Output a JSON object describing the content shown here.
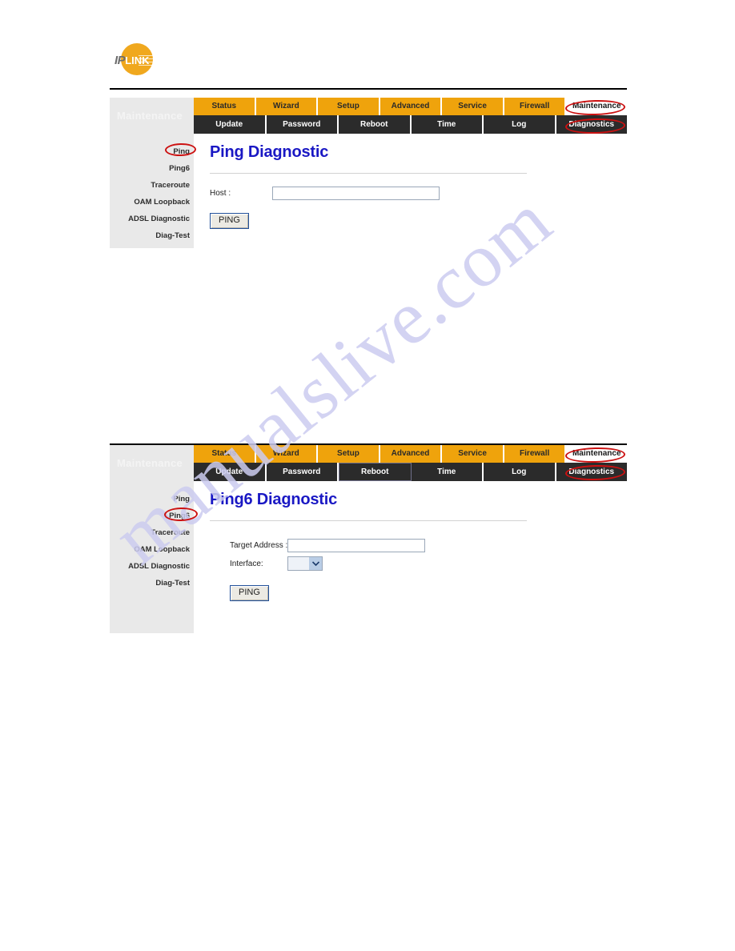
{
  "watermark": {
    "text": "manualslive.com"
  },
  "logo": {
    "part1": "IP",
    "part2": "LINK",
    "name": "iplink-logo"
  },
  "nav": {
    "brand": "Maintenance",
    "primary_tabs": [
      "Status",
      "Wizard",
      "Setup",
      "Advanced",
      "Service",
      "Firewall",
      "Maintenance"
    ],
    "secondary_tabs": [
      "Update",
      "Password",
      "Reboot",
      "Time",
      "Log",
      "Diagnostics"
    ],
    "active_primary": "Maintenance",
    "active_secondary": "Diagnostics"
  },
  "sidebar": {
    "items": [
      "Ping",
      "Ping6",
      "Traceroute",
      "OAM Loopback",
      "ADSL Diagnostic",
      "Diag-Test"
    ]
  },
  "panel_ping": {
    "title": "Ping Diagnostic",
    "host_label": "Host :",
    "host_value": "",
    "host_placeholder": "",
    "button_label": "PING",
    "highlighted_sidebar_item": "Ping"
  },
  "panel_ping6": {
    "title": "Ping6 Diagnostic",
    "target_label": "Target Address :",
    "target_value": "",
    "target_placeholder": "",
    "interface_label": "Interface:",
    "interface_value": "",
    "button_label": "PING",
    "highlighted_sidebar_item": "Ping6",
    "hovered_secondary_tab": "Reboot"
  },
  "colors": {
    "nav_orange": "#EFA30C",
    "nav_dark": "#2b2b2b",
    "title_blue": "#1a18c4",
    "sidebar_gray": "#e9e9e9",
    "annotation_red": "#cc1111",
    "watermark_lavender": "#ccccf0"
  }
}
